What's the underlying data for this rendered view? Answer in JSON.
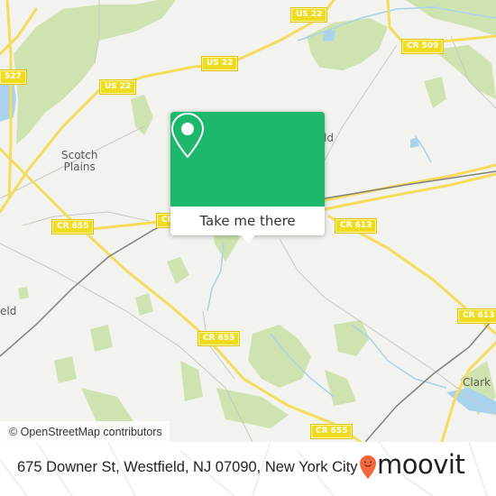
{
  "map": {
    "colors": {
      "background": "#f2f2ee",
      "park": "#cfe3b0",
      "park_dark": "#bcd99a",
      "water": "#a9d3ec",
      "road_major": "#f5dc5c",
      "road_minor": "#c8c8c4",
      "rail": "#808080"
    },
    "road_shields": [
      {
        "id": "us22-a",
        "label": "US 22"
      },
      {
        "id": "us22-b",
        "label": "US 22"
      },
      {
        "id": "us22-c",
        "label": "US 22"
      },
      {
        "id": "cr527",
        "label": "527"
      },
      {
        "id": "cr509",
        "label": "CR 509"
      },
      {
        "id": "cr655-a",
        "label": "CR 655"
      },
      {
        "id": "cr655-b",
        "label": "CR"
      },
      {
        "id": "cr613-a",
        "label": "CR 613"
      },
      {
        "id": "cr613-b",
        "label": "CR 613"
      },
      {
        "id": "cr655-c",
        "label": "CR 655"
      },
      {
        "id": "cr655-d",
        "label": "CR 655"
      }
    ],
    "places": [
      {
        "id": "scotch-plains",
        "label": "Scotch\nPlains"
      },
      {
        "id": "westfield-partial",
        "label": "eld"
      },
      {
        "id": "mountainside-partial",
        "label": "ld"
      },
      {
        "id": "clark",
        "label": "Clark"
      }
    ],
    "attribution": "© OpenStreetMap contributors"
  },
  "popup": {
    "icon": "map-pin-icon",
    "button_label": "Take me there",
    "color": "#1db86b"
  },
  "footer": {
    "address": "675 Downer St, Westfield, NJ 07090, New York City",
    "brand": "moovit",
    "brand_color": "#f26a3c"
  }
}
